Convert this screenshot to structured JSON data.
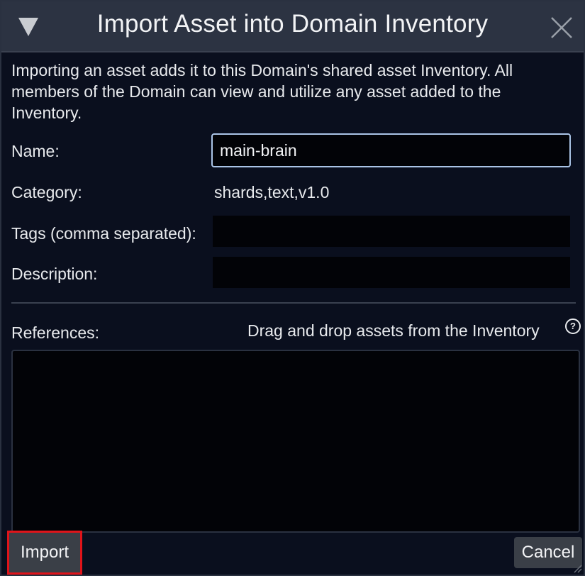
{
  "dialog": {
    "title": "Import Asset into Domain Inventory",
    "intro": "Importing an asset adds it to this Domain's shared asset Inventory. All members of the Domain can view and utilize any asset added to the Inventory."
  },
  "form": {
    "name_label": "Name:",
    "name_value": "main-brain",
    "category_label": "Category:",
    "category_value": "shards,text,v1.0",
    "tags_label": "Tags (comma separated):",
    "tags_value": "",
    "description_label": "Description:",
    "description_value": ""
  },
  "references": {
    "label": "References:",
    "hint": "Drag and drop assets from the Inventory",
    "help_glyph": "?"
  },
  "buttons": {
    "import_label": "Import",
    "cancel_label": "Cancel"
  },
  "colors": {
    "titlebar": "#2c3342",
    "background": "#0a0f1e",
    "input_background": "#020307",
    "active_input_border": "#aac4e6",
    "button": "#3a3f47",
    "highlight": "#e0141a"
  },
  "icons": {
    "collapse": "triangle-down-icon",
    "close": "close-icon",
    "help": "question-circle-icon",
    "resize": "resize-grip-icon"
  }
}
